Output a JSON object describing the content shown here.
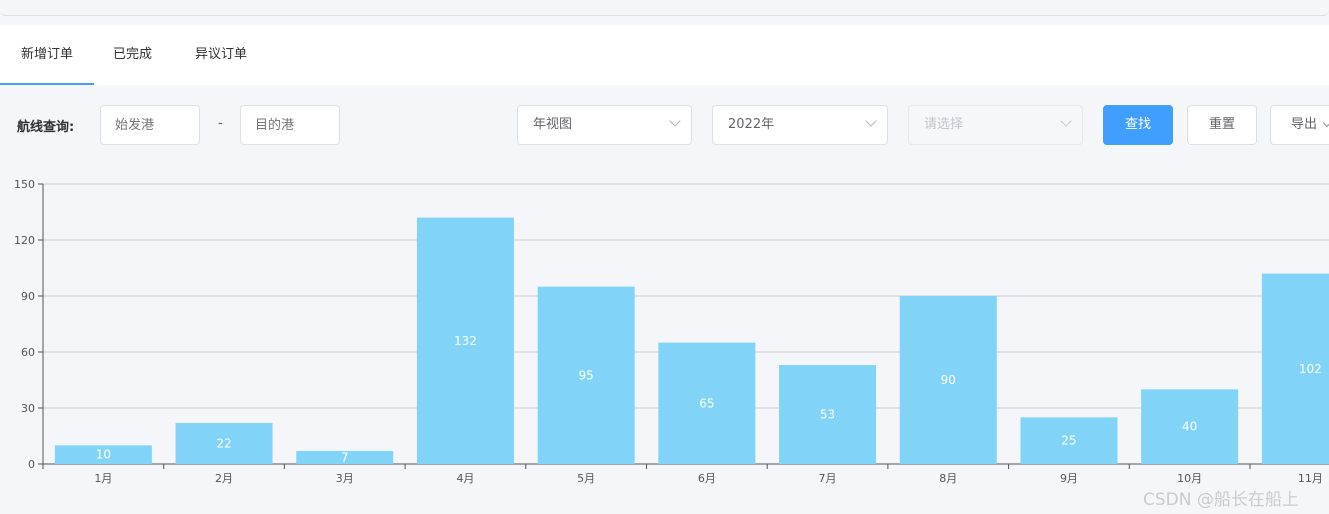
{
  "tabs": [
    {
      "label": "新增订单",
      "active": true
    },
    {
      "label": "已完成",
      "active": false
    },
    {
      "label": "异议订单",
      "active": false
    }
  ],
  "filters": {
    "route_label": "航线查询:",
    "origin_placeholder": "始发港",
    "separator": "-",
    "dest_placeholder": "目的港",
    "view_value": "年视图",
    "year_value": "2022年",
    "third_placeholder": "请选择",
    "search_label": "查找",
    "reset_label": "重置",
    "export_label": "导出"
  },
  "colors": {
    "bar": "#81d3f8",
    "primary": "#409eff"
  },
  "chart_data": {
    "type": "bar",
    "categories": [
      "1月",
      "2月",
      "3月",
      "4月",
      "5月",
      "6月",
      "7月",
      "8月",
      "9月",
      "10月",
      "11月"
    ],
    "values": [
      10,
      22,
      7,
      132,
      95,
      65,
      53,
      90,
      25,
      40,
      102
    ],
    "yticks": [
      0,
      30,
      60,
      90,
      120,
      150
    ],
    "ylim": [
      0,
      150
    ],
    "grid": true,
    "data_labels": true
  },
  "watermark": "CSDN @船长在船上"
}
